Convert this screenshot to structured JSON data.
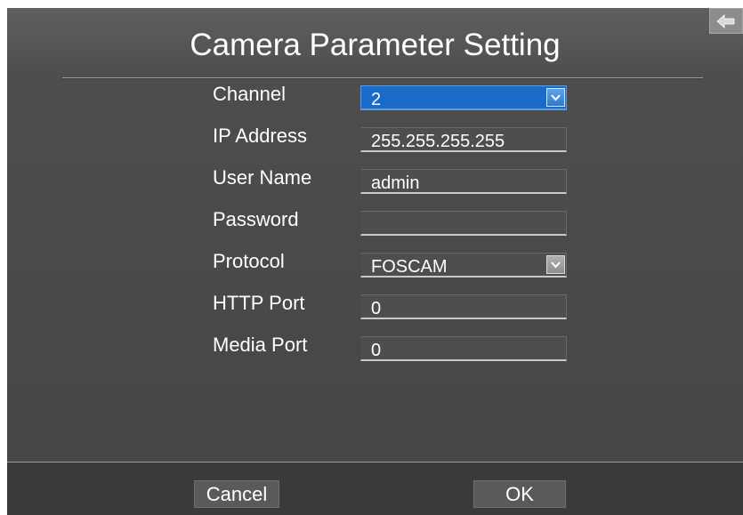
{
  "window": {
    "title": "Camera Parameter Setting"
  },
  "form": {
    "channel": {
      "label": "Channel",
      "value": "2"
    },
    "ip_address": {
      "label": "IP Address",
      "value": "255.255.255.255"
    },
    "user_name": {
      "label": "User Name",
      "value": "admin"
    },
    "password": {
      "label": "Password",
      "value": ""
    },
    "protocol": {
      "label": "Protocol",
      "value": "FOSCAM"
    },
    "http_port": {
      "label": "HTTP Port",
      "value": "0"
    },
    "media_port": {
      "label": "Media Port",
      "value": "0"
    }
  },
  "footer": {
    "cancel_label": "Cancel",
    "ok_label": "OK"
  },
  "icons": {
    "back": "back-arrow-icon",
    "dropdown": "chevron-down-icon"
  },
  "colors": {
    "background": "#4d4d4d",
    "selected_field": "#1a6bc8",
    "footer": "#3a3a3a",
    "text": "#ffffff"
  }
}
